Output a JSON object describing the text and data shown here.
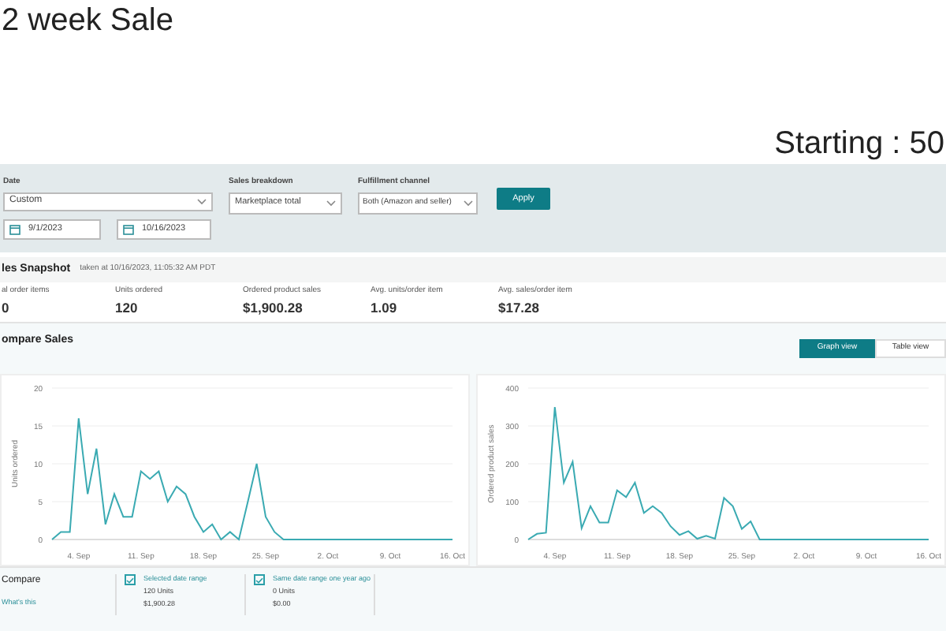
{
  "heading": "2 week Sale",
  "subheading": "Starting : 50",
  "filters": {
    "date": {
      "label": "Date",
      "value": "Custom",
      "from": "9/1/2023",
      "to": "10/16/2023"
    },
    "sales_breakdown": {
      "label": "Sales breakdown",
      "value": "Marketplace total"
    },
    "fulfillment_channel": {
      "label": "Fulfillment channel",
      "value": "Both (Amazon and seller)"
    },
    "apply": "Apply"
  },
  "snapshot": {
    "title": "les Snapshot",
    "taken": "taken at 10/16/2023, 11:05:32 AM PDT",
    "metrics": [
      {
        "label": "al order items",
        "value": "0"
      },
      {
        "label": "Units ordered",
        "value": "120"
      },
      {
        "label": "Ordered product sales",
        "value": "$1,900.28"
      },
      {
        "label": "Avg. units/order item",
        "value": "1.09"
      },
      {
        "label": "Avg. sales/order item",
        "value": "$17.28"
      }
    ]
  },
  "compare_sales": {
    "title": "ompare Sales",
    "tabs": [
      {
        "label": "Graph view",
        "selected": true
      },
      {
        "label": "Table view",
        "selected": false
      }
    ],
    "charts": [
      {
        "chart_data": {
          "type": "line",
          "ylabel": "Units ordered",
          "categories": [
            null,
            null,
            null,
            "4. Sep",
            null,
            null,
            null,
            null,
            null,
            null,
            "11. Sep",
            null,
            null,
            null,
            null,
            null,
            null,
            "18. Sep",
            null,
            null,
            null,
            null,
            null,
            null,
            "25. Sep",
            null,
            null,
            null,
            null,
            null,
            null,
            "2. Oct",
            null,
            null,
            null,
            null,
            null,
            null,
            "9. Oct",
            null,
            null,
            null,
            null,
            null,
            null,
            "16. Oct"
          ],
          "series": [
            {
              "color": "#3aaab2",
              "values": [
                0,
                1,
                1,
                16,
                6,
                12,
                2,
                6,
                3,
                3,
                9,
                8,
                9,
                5,
                7,
                6,
                3,
                1,
                2,
                0,
                1,
                0,
                5,
                10,
                3,
                1,
                0,
                0,
                0,
                0,
                0,
                0,
                0,
                0,
                0,
                0,
                0,
                0,
                0,
                0,
                0,
                0,
                0,
                0,
                0,
                0
              ]
            }
          ],
          "ylim": [
            0,
            20
          ],
          "yticks": [
            0,
            5,
            10,
            15,
            20
          ],
          "grid": true
        }
      },
      {
        "chart_data": {
          "type": "line",
          "ylabel": "Ordered product sales",
          "categories": [
            null,
            null,
            null,
            "4. Sep",
            null,
            null,
            null,
            null,
            null,
            null,
            "11. Sep",
            null,
            null,
            null,
            null,
            null,
            null,
            "18. Sep",
            null,
            null,
            null,
            null,
            null,
            null,
            "25. Sep",
            null,
            null,
            null,
            null,
            null,
            null,
            "2. Oct",
            null,
            null,
            null,
            null,
            null,
            null,
            "9. Oct",
            null,
            null,
            null,
            null,
            null,
            null,
            "16. Oct"
          ],
          "series": [
            {
              "color": "#3aaab2",
              "values": [
                0,
                15,
                18,
                350,
                150,
                205,
                30,
                88,
                45,
                45,
                130,
                112,
                150,
                70,
                88,
                70,
                35,
                12,
                22,
                2,
                10,
                2,
                110,
                88,
                28,
                48,
                0,
                0,
                0,
                0,
                0,
                0,
                0,
                0,
                0,
                0,
                0,
                0,
                0,
                0,
                0,
                0,
                0,
                0,
                0,
                0
              ]
            }
          ],
          "ylim": [
            0,
            400
          ],
          "yticks": [
            0,
            100,
            200,
            300,
            400
          ],
          "grid": true
        }
      }
    ]
  },
  "compare": {
    "title": "Compare",
    "link": "What's this",
    "items": [
      {
        "label": "Selected date range",
        "units": "120 Units",
        "amount": "$1,900.28",
        "checked": true
      },
      {
        "label": "Same date range one year ago",
        "units": "0 Units",
        "amount": "$0.00",
        "checked": true
      }
    ]
  }
}
